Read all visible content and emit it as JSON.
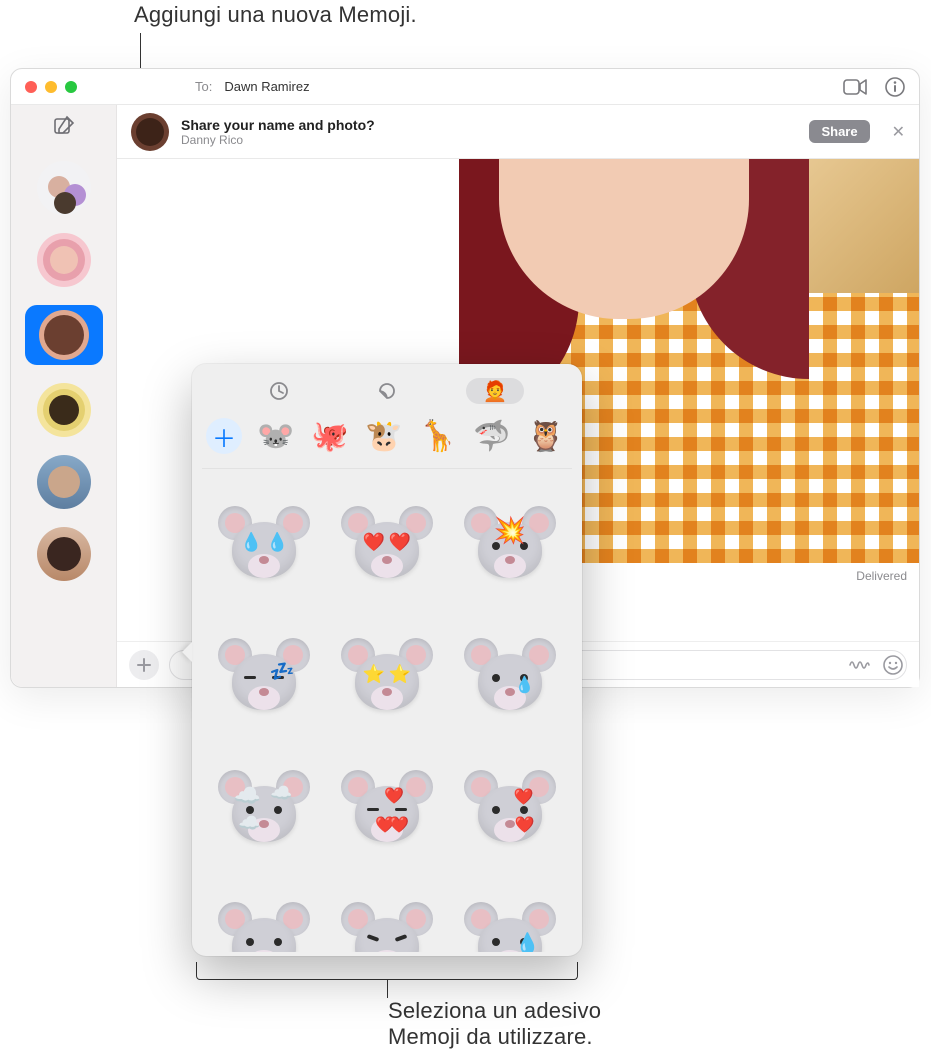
{
  "annotations": {
    "top": "Aggiungi una nuova Memoji.",
    "bottom_line1": "Seleziona un adesivo",
    "bottom_line2": "Memoji da utilizzare."
  },
  "titlebar": {
    "to_label": "To:",
    "to_name": "Dawn Ramirez"
  },
  "share_banner": {
    "question": "Share your name and photo?",
    "subtitle": "Danny Rico",
    "share_btn": "Share",
    "close": "✕"
  },
  "conversation": {
    "delivered": "Delivered"
  },
  "input": {
    "placeholder": ""
  },
  "popover": {
    "tabs": {
      "recent": "clock",
      "stickers": "sticker",
      "memoji": "memoji"
    },
    "memoji_row": [
      {
        "name": "add",
        "glyph": "＋"
      },
      {
        "name": "mouse",
        "glyph": "🐭"
      },
      {
        "name": "octopus",
        "glyph": "🐙"
      },
      {
        "name": "cow",
        "glyph": "🐮"
      },
      {
        "name": "giraffe",
        "glyph": "🦒"
      },
      {
        "name": "shark",
        "glyph": "🦈"
      },
      {
        "name": "owl",
        "glyph": "🦉"
      }
    ],
    "stickers": [
      {
        "name": "mouse-tears-of-joy"
      },
      {
        "name": "mouse-heart-eyes"
      },
      {
        "name": "mouse-mind-blown"
      },
      {
        "name": "mouse-sleeping"
      },
      {
        "name": "mouse-starstruck"
      },
      {
        "name": "mouse-crying"
      },
      {
        "name": "mouse-in-clouds"
      },
      {
        "name": "mouse-blowing-kiss"
      },
      {
        "name": "mouse-two-hearts"
      },
      {
        "name": "mouse-worried"
      },
      {
        "name": "mouse-angry"
      },
      {
        "name": "mouse-cold-sweat"
      }
    ]
  },
  "sidebar": {
    "items": [
      {
        "name": "group-chat"
      },
      {
        "name": "contact-pink"
      },
      {
        "name": "contact-dawn-selected"
      },
      {
        "name": "contact-yellow-glasses"
      },
      {
        "name": "contact-photo-1"
      },
      {
        "name": "contact-photo-2"
      }
    ]
  }
}
